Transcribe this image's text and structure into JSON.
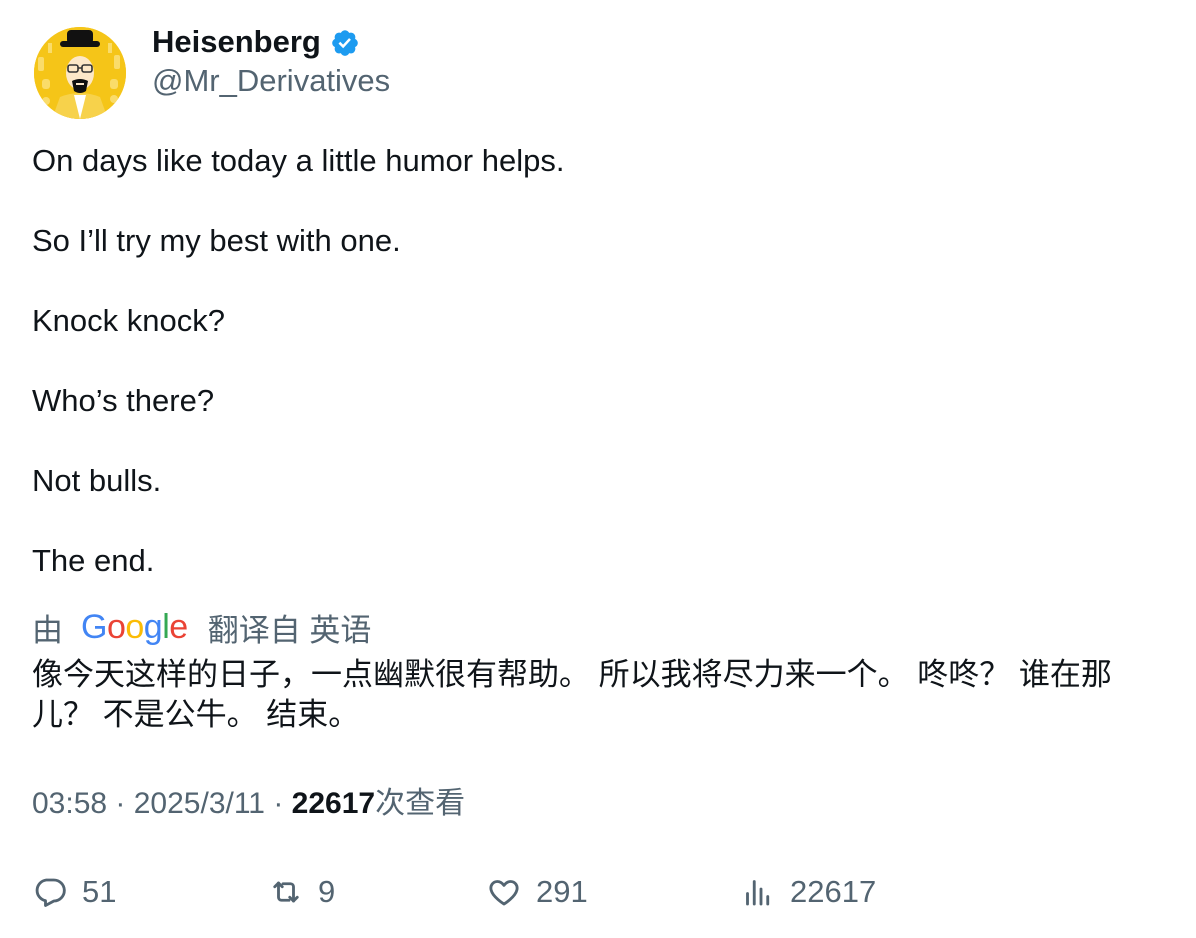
{
  "author": {
    "display_name": "Heisenberg",
    "handle": "@Mr_Derivatives",
    "verified": true,
    "avatar_icon": "heisenberg-avatar-icon"
  },
  "tweet": {
    "lines": [
      "On days like today a little humor helps.",
      "So I’ll try my best with one.",
      "Knock knock?",
      "Who’s there?",
      "Not bulls.",
      "The end."
    ]
  },
  "translation": {
    "prefix": "由",
    "provider": "Google",
    "suffix": "翻译自 英语",
    "text": "像今天这样的日子，一点幽默很有帮助。 所以我将尽力来一个。 咚咚？ 谁在那儿？ 不是公牛。 结束。"
  },
  "meta": {
    "time": "03:58",
    "separator": "·",
    "date": "2025/3/11",
    "views_count": "22617",
    "views_label": "次查看"
  },
  "actions": {
    "replies": "51",
    "retweets": "9",
    "likes": "291",
    "views": "22617"
  },
  "colors": {
    "text": "#0f1419",
    "secondary": "#536471",
    "verified": "#1d9bf0",
    "avatar_bg": "#f5c518"
  }
}
